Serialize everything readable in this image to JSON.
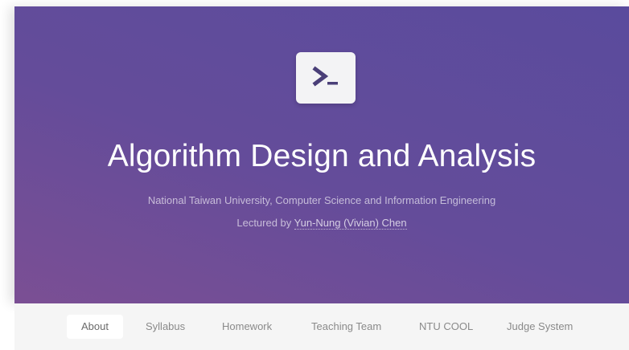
{
  "hero": {
    "title": "Algorithm Design and Analysis",
    "subtitle": "National Taiwan University, Computer Science and Information Engineering",
    "lecturer_prefix": "Lectured by ",
    "lecturer_name": "Yun-Nung (Vivian) Chen",
    "logo_icon": "terminal-prompt-icon",
    "gradient_colors": [
      "#7b4f94",
      "#5a4b9d"
    ]
  },
  "nav": {
    "items": [
      {
        "label": "About",
        "active": true
      },
      {
        "label": "Syllabus"
      },
      {
        "label": "Homework"
      },
      {
        "label": "Teaching Team"
      },
      {
        "label": "NTU COOL"
      },
      {
        "label": "Judge System"
      }
    ]
  }
}
